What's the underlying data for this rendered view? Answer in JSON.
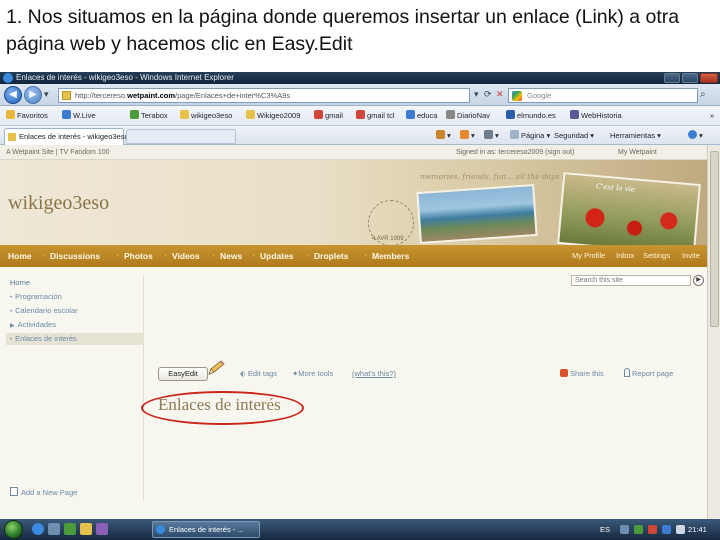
{
  "caption": "1. Nos situamos en la página donde queremos insertar un enlace (Link) a otra página web y hacemos clic en Easy.Edit",
  "browser": {
    "window_title": "Enlaces de interés - wikigeo3eso - Windows Internet Explorer",
    "url_prefix": "http://tercereso.",
    "url_domain": "wetpaint.com",
    "url_suffix": "/page/Enlaces+de+inter%C3%A9s",
    "search_placeholder": "Google",
    "favorites_label": "Favoritos",
    "favorites": [
      "W.Live",
      "Terabox",
      "wikigeo3eso",
      "Wikigeo2009",
      "gmail",
      "gmail tcl",
      "educa",
      "DiarioNav",
      "elmundo.es",
      "WebHistoria"
    ],
    "tab_label": "Enlaces de interés - wikigeo3eso",
    "commands": [
      "Página",
      "Seguridad",
      "Herramientas"
    ]
  },
  "site": {
    "topbar_left": "A Wetpaint Site | TV Fandom 100",
    "topbar_right": "Signed in as: tercereso2009 (sign out)",
    "my_wetpaint": "My Wetpaint",
    "title": "wikigeo3eso",
    "tagline": "memories, friends, fun... all the days of life...",
    "stamp_text": "C'est la vie",
    "postmark_date": "4 AVR 1999",
    "nav": [
      "Home",
      "Discussions",
      "Photos",
      "Videos",
      "News",
      "Updates",
      "Droplets",
      "Members"
    ],
    "nav_right": [
      "My Profile",
      "Inbox",
      "Settings",
      "Invite"
    ],
    "search_placeholder": "Search this site",
    "sidebar": {
      "home": "Home",
      "items": [
        "Programación",
        "Calendario escolar",
        "Actividades",
        "Enlaces de interés"
      ],
      "active_index": 3,
      "add_page": "Add a New Page"
    },
    "page_tools": {
      "easyedit": "EasyEdit",
      "edit_tags": "Edit tags",
      "more_tools": "More tools",
      "whats_this": "(what's this?)",
      "share": "Share this",
      "report": "Report page"
    },
    "page_heading": "Enlaces de interés"
  },
  "taskbar": {
    "task_label": "Enlaces de interés - ...",
    "language": "ES",
    "clock": "21:41"
  },
  "colors": {
    "nav_bar": "#b98422",
    "annotation": "#c8261b",
    "link": "#6c8aa8"
  }
}
